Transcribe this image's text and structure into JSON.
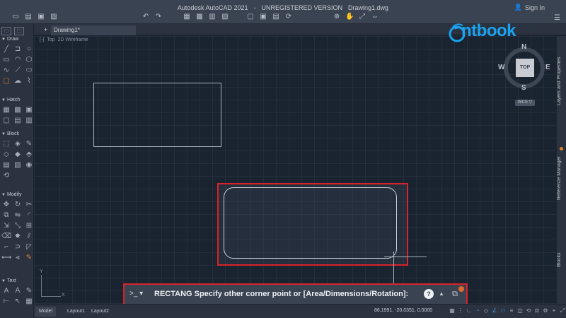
{
  "window": {
    "app_name": "Autodesk AutoCAD 2021",
    "separator": "-",
    "version_note": "UNREGISTERED VERSION",
    "file_name": "Drawing1.dwg",
    "sign_in": "Sign In"
  },
  "tabs": {
    "document": "Drawing1*",
    "add": "+"
  },
  "viewport": {
    "toggle": "[-]",
    "view": "Top",
    "visual_style": "2D Wireframe"
  },
  "left_panels": {
    "draw": "Draw",
    "hatch": "Hatch",
    "block": "Block",
    "modify": "Modify",
    "text": "Text"
  },
  "viewcube": {
    "n": "N",
    "s": "S",
    "e": "E",
    "w": "W",
    "top": "TOP",
    "wcs": "WCS ▽"
  },
  "watermark": {
    "brand": "ntbook"
  },
  "right_palettes": {
    "layers": "Layers and Properties",
    "reference": "Reference Manager",
    "blocks": "Blocks"
  },
  "ucs": {
    "x": "X",
    "y": "Y"
  },
  "command_line": {
    "prompt": ">_ ▾",
    "text": "RECTANG Specify other corner point or [Area/Dimensions/Rotation]:",
    "help": "?"
  },
  "status": {
    "model": "Model",
    "layout1": "Layout1",
    "layout2": "Layout2",
    "coordinates": "86.1991, -20.0351, 0.0000"
  },
  "colors": {
    "highlight": "#d8232a",
    "accent": "#1aa3f0",
    "notification": "#e06a2a"
  }
}
